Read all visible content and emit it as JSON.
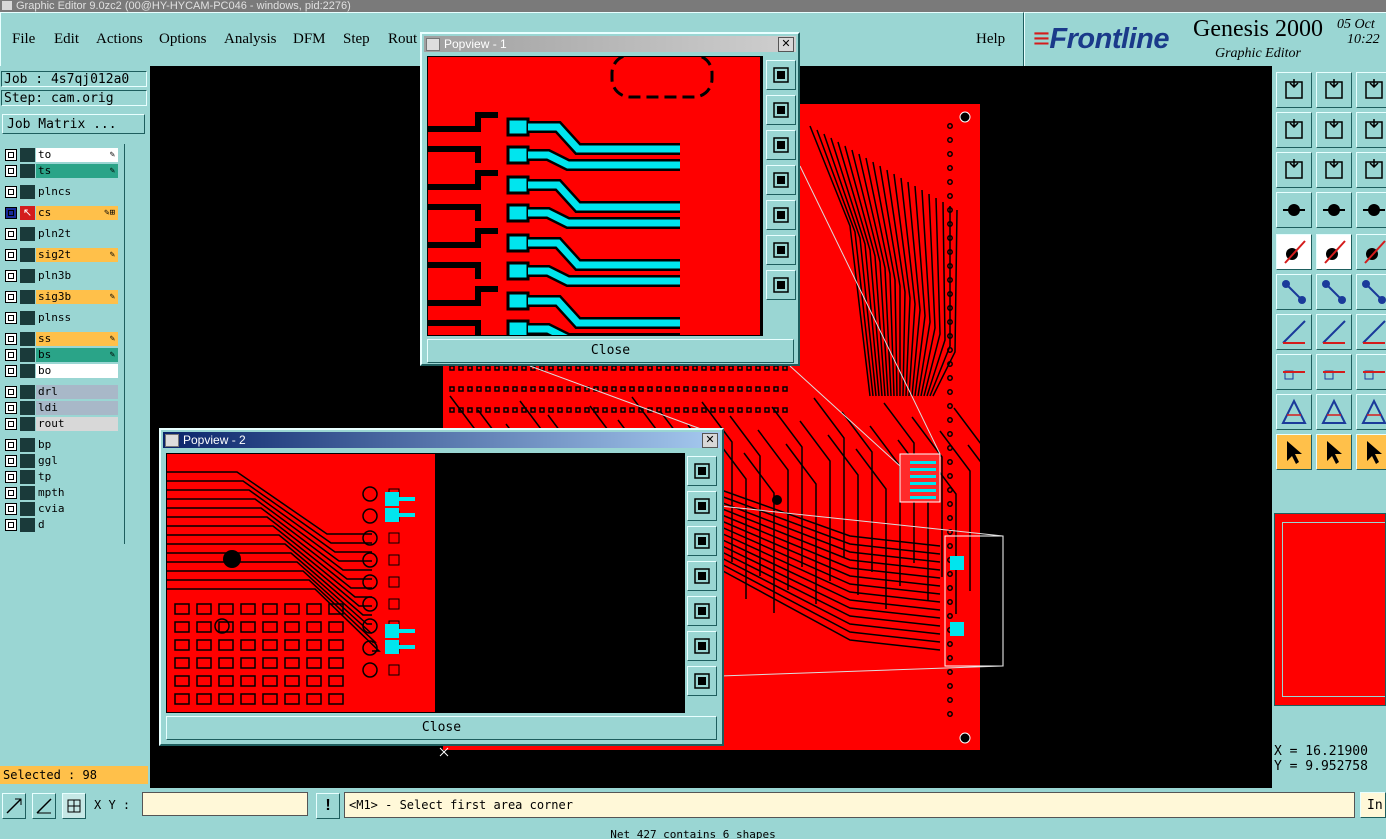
{
  "window": {
    "title": "Graphic Editor 9.0zc2 (00@HY-HYCAM-PC046 - windows, pid:2276)"
  },
  "menu": {
    "items": [
      "File",
      "Edit",
      "Actions",
      "Options",
      "Analysis",
      "DFM",
      "Step",
      "Rout"
    ],
    "help": "Help"
  },
  "brand": {
    "logo": "Frontline",
    "product": "Genesis 2000",
    "subtitle": "Graphic Editor",
    "date": "05 Oct",
    "time": "10:22"
  },
  "job": {
    "job_label": "Job : 4s7qj012a0",
    "step_label": "Step: cam.orig",
    "matrix_button": "Job Matrix ..."
  },
  "layers": [
    {
      "name": "to",
      "color": "#ffffff",
      "mark": "✎"
    },
    {
      "name": "ts",
      "color": "#2aa488",
      "mark": "✎"
    },
    {
      "name": "plncs",
      "color": "#9ad6d3",
      "mark": ""
    },
    {
      "name": "cs",
      "color": "#ffc04a",
      "mark": "✎⊞",
      "active": true
    },
    {
      "name": "pln2t",
      "color": "#9ad6d3",
      "mark": ""
    },
    {
      "name": "sig2t",
      "color": "#ffc04a",
      "mark": "✎"
    },
    {
      "name": "pln3b",
      "color": "#9ad6d3",
      "mark": ""
    },
    {
      "name": "sig3b",
      "color": "#ffc04a",
      "mark": "✎"
    },
    {
      "name": "plnss",
      "color": "#9ad6d3",
      "mark": ""
    },
    {
      "name": "ss",
      "color": "#ffc04a",
      "mark": "✎"
    },
    {
      "name": "bs",
      "color": "#2aa488",
      "mark": "✎"
    },
    {
      "name": "bo",
      "color": "#ffffff",
      "mark": ""
    },
    {
      "name": "drl",
      "color": "#a8b8c8",
      "mark": ""
    },
    {
      "name": "ldi",
      "color": "#a8b8c8",
      "mark": ""
    },
    {
      "name": "rout",
      "color": "#d8d8d8",
      "mark": ""
    },
    {
      "name": "bp",
      "color": "#9ad6d3",
      "mark": ""
    },
    {
      "name": "ggl",
      "color": "#9ad6d3",
      "mark": ""
    },
    {
      "name": "tp",
      "color": "#9ad6d3",
      "mark": ""
    },
    {
      "name": "mpth",
      "color": "#9ad6d3",
      "mark": ""
    },
    {
      "name": "cvia",
      "color": "#9ad6d3",
      "mark": ""
    },
    {
      "name": "d",
      "color": "#9ad6d3",
      "mark": ""
    }
  ],
  "selected": "Selected : 98",
  "popup1": {
    "title": "Popview - 1",
    "close_label": "Close"
  },
  "popup2": {
    "title": "Popview - 2",
    "close_label": "Close"
  },
  "coords": {
    "x": "X = 16.21900",
    "y": "Y = 9.952758"
  },
  "status": {
    "xy_label": "X Y :",
    "xy_value": "",
    "prompt": "<M1> - Select first area corner",
    "info_button": "In",
    "message": "Net 427 contains 6 shapes"
  },
  "colors": {
    "board": "#ff0000",
    "highlight": "#00e5ee",
    "panel": "#9ad6d3",
    "orange": "#ffc04a"
  }
}
